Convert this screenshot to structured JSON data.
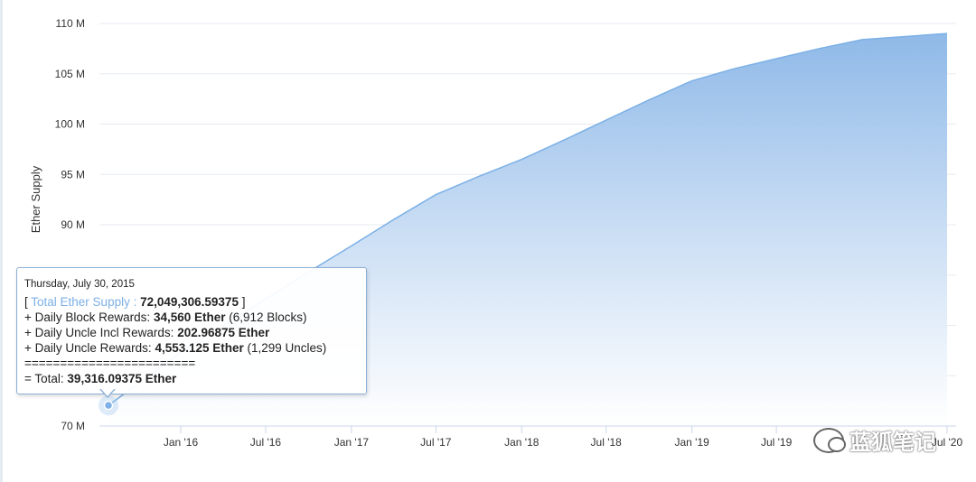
{
  "chart_data": {
    "type": "area",
    "title": "",
    "ylabel": "Ether Supply",
    "xlabel": "",
    "ylim": [
      70000000,
      110000000
    ],
    "y_ticks": [
      {
        "value": 70000000,
        "label": "70 M"
      },
      {
        "value": 75000000,
        "label": ""
      },
      {
        "value": 80000000,
        "label": ""
      },
      {
        "value": 85000000,
        "label": ""
      },
      {
        "value": 90000000,
        "label": "90 M"
      },
      {
        "value": 95000000,
        "label": "95 M"
      },
      {
        "value": 100000000,
        "label": "100 M"
      },
      {
        "value": 105000000,
        "label": "105 M"
      },
      {
        "value": 110000000,
        "label": "110 M"
      }
    ],
    "xlim": [
      "2015-07-30",
      "2020-07-01"
    ],
    "x_ticks": [
      {
        "date": "2016-01-01",
        "label": "Jan '16"
      },
      {
        "date": "2016-07-01",
        "label": "Jul '16"
      },
      {
        "date": "2017-01-01",
        "label": "Jan '17"
      },
      {
        "date": "2017-07-01",
        "label": "Jul '17"
      },
      {
        "date": "2018-01-01",
        "label": "Jan '18"
      },
      {
        "date": "2018-07-01",
        "label": "Jul '18"
      },
      {
        "date": "2019-01-01",
        "label": "Jan '19"
      },
      {
        "date": "2019-07-01",
        "label": "Jul '19"
      },
      {
        "date": "2020-07-01",
        "label": "Jul '20"
      }
    ],
    "series": [
      {
        "points": [
          {
            "date": "2015-07-30",
            "value": 72049306.59
          },
          {
            "date": "2015-10-01",
            "value": 74200000
          },
          {
            "date": "2016-01-01",
            "value": 77300000
          },
          {
            "date": "2016-04-01",
            "value": 80000000
          },
          {
            "date": "2016-07-01",
            "value": 82600000
          },
          {
            "date": "2016-10-01",
            "value": 85300000
          },
          {
            "date": "2017-01-01",
            "value": 87900000
          },
          {
            "date": "2017-04-01",
            "value": 90500000
          },
          {
            "date": "2017-07-01",
            "value": 93000000
          },
          {
            "date": "2017-10-01",
            "value": 94800000
          },
          {
            "date": "2018-01-01",
            "value": 96500000
          },
          {
            "date": "2018-04-01",
            "value": 98400000
          },
          {
            "date": "2018-07-01",
            "value": 100400000
          },
          {
            "date": "2018-10-01",
            "value": 102400000
          },
          {
            "date": "2019-01-01",
            "value": 104300000
          },
          {
            "date": "2019-04-01",
            "value": 105500000
          },
          {
            "date": "2019-07-01",
            "value": 106500000
          },
          {
            "date": "2019-10-01",
            "value": 107500000
          },
          {
            "date": "2020-01-01",
            "value": 108400000
          },
          {
            "date": "2020-07-01",
            "value": 109000000
          }
        ]
      }
    ],
    "grid": true,
    "colors": {
      "fill_top": "#8fb9e8",
      "fill_bottom": "#ffffff",
      "line": "#7cb0e6",
      "marker": "#7cb0e6"
    }
  },
  "tooltip": {
    "date": "Thursday, July 30, 2015",
    "open_bracket": "[ ",
    "series_label": "Total Ether Supply : ",
    "total_supply": "72,049,306.59375",
    "close_bracket": " ]",
    "block_rewards_prefix": "+ Daily Block Rewards: ",
    "block_rewards_value": "34,560 Ether",
    "block_rewards_suffix": " (6,912 Blocks)",
    "uncle_incl_prefix": "+ Daily Uncle Incl Rewards: ",
    "uncle_incl_value": "202.96875 Ether",
    "uncle_rewards_prefix": "+ Daily Uncle Rewards: ",
    "uncle_rewards_value": "4,553.125 Ether",
    "uncle_rewards_suffix": " (1,299 Uncles)",
    "separator": "========================",
    "total_prefix": "= Total: ",
    "total_value": "39,316.09375 Ether"
  },
  "watermark": {
    "text": "蓝狐笔记",
    "icon": "wechat-icon"
  }
}
